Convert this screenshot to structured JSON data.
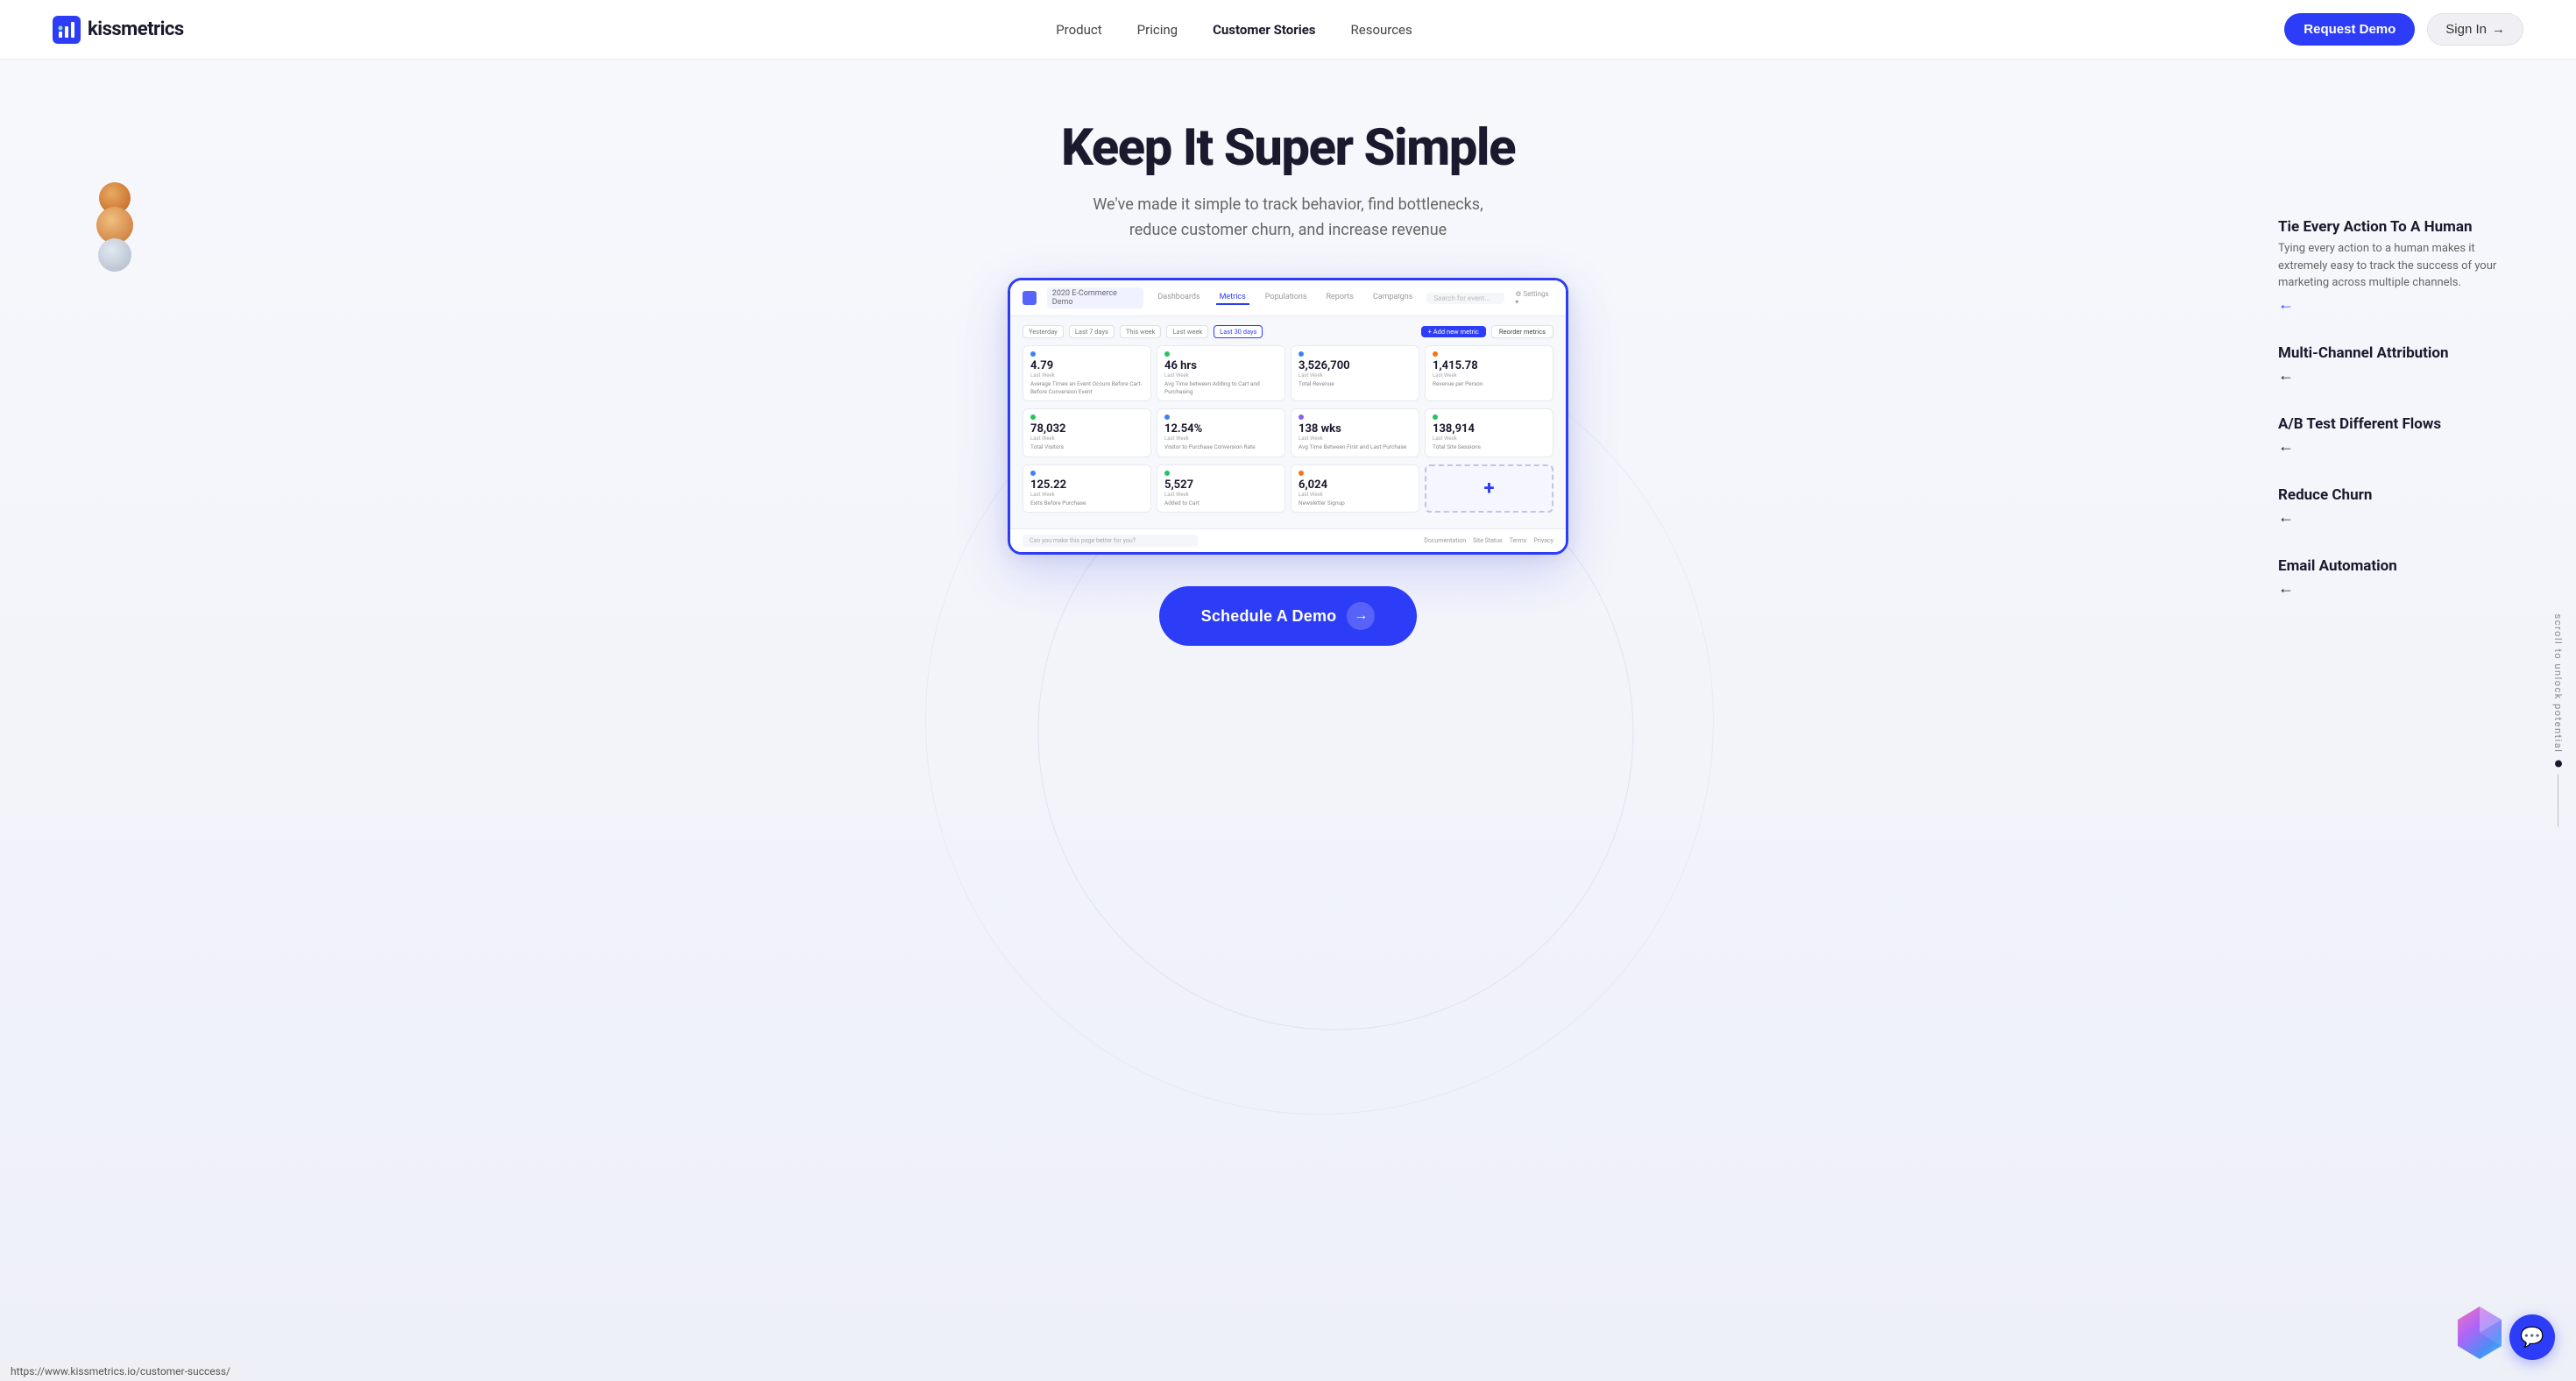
{
  "nav": {
    "logo_text": "kissmetrics",
    "links": [
      {
        "id": "product",
        "label": "Product",
        "active": false
      },
      {
        "id": "pricing",
        "label": "Pricing",
        "active": false
      },
      {
        "id": "customer-stories",
        "label": "Customer Stories",
        "active": true
      },
      {
        "id": "resources",
        "label": "Resources",
        "active": false
      }
    ],
    "request_demo": "Request Demo",
    "sign_in": "Sign In"
  },
  "hero": {
    "title": "Keep It Super Simple",
    "subtitle_line1": "We've made it simple to track behavior, find bottlenecks,",
    "subtitle_line2": "reduce customer churn, and increase revenue"
  },
  "dashboard": {
    "demo_label": "2020 E-Commerce Demo",
    "tabs": [
      "Dashboards",
      "Metrics",
      "Populations",
      "Reports",
      "Campaigns"
    ],
    "active_tab": "Metrics",
    "search_placeholder": "Search for event",
    "settings_label": "Settings",
    "date_filters": [
      "Yesterday",
      "Last 7 days",
      "This week",
      "Last week",
      "Last 30 days"
    ],
    "active_date": "Last 30 days",
    "add_metric_label": "Add new metric",
    "reorder_label": "Reorder metrics",
    "metrics_row1": [
      {
        "value": "4.79",
        "label": "Average Times an Event Occurs Before Cart-Before Conversion Event",
        "last": "Last Week",
        "dot_color": "blue"
      },
      {
        "value": "46 hrs",
        "label": "Avg Time between Adding to Cart and Purchasing",
        "last": "Last Week",
        "dot_color": "green"
      },
      {
        "value": "3,526,700",
        "label": "Total Revenue",
        "last": "Last Week",
        "dot_color": "blue"
      },
      {
        "value": "1,415.78",
        "label": "Revenue per Person",
        "last": "Last Week",
        "dot_color": "orange"
      }
    ],
    "metrics_row2": [
      {
        "value": "78,032",
        "label": "Total Visitors",
        "last": "Last Week",
        "dot_color": "green"
      },
      {
        "value": "12.54%",
        "label": "Visitor to Purchase Conversion Rate",
        "last": "Last Week",
        "dot_color": "blue"
      },
      {
        "value": "138 wks",
        "label": "Avg Time Between First and Last Purchase",
        "last": "Last Week",
        "dot_color": "purple"
      },
      {
        "value": "138,914",
        "label": "Total Site Sessions",
        "last": "Last Week",
        "dot_color": "green"
      }
    ],
    "metrics_row3": [
      {
        "value": "125.22",
        "label": "Exits Before Purchase",
        "last": "Last Week",
        "dot_color": "blue"
      },
      {
        "value": "5,527",
        "label": "Added to Cart",
        "last": "Last Week",
        "dot_color": "green"
      },
      {
        "value": "6,024",
        "label": "Newsletter Signup",
        "last": "Last Week",
        "dot_color": "orange"
      },
      {
        "value": "+",
        "label": "Add new metric",
        "last": "",
        "dot_color": "blue"
      }
    ],
    "footer_input_placeholder": "Can you make this page better for you?",
    "footer_links": [
      "Documentation",
      "Site Status",
      "Terms",
      "Privacy"
    ]
  },
  "features": [
    {
      "id": "tie-action",
      "title": "Tie Every Action To A Human",
      "desc": "Tying every action to a human makes it extremely easy to track the success of your marketing across multiple channels.",
      "has_desc": true,
      "active": true
    },
    {
      "id": "multi-channel",
      "title": "Multi-Channel Attribution",
      "desc": "",
      "has_desc": false,
      "active": false
    },
    {
      "id": "ab-test",
      "title": "A/B Test Different Flows",
      "desc": "",
      "has_desc": false,
      "active": false
    },
    {
      "id": "reduce-churn",
      "title": "Reduce Churn",
      "desc": "",
      "has_desc": false,
      "active": false
    },
    {
      "id": "email-automation",
      "title": "Email Automation",
      "desc": "",
      "has_desc": false,
      "active": false
    }
  ],
  "cta": {
    "label": "Schedule A Demo",
    "arrow": "→"
  },
  "scroll_indicator": {
    "text": "scroll to unlock potential"
  },
  "url_bar": {
    "url": "https://www.kissmetrics.io/customer-success/"
  },
  "icons": {
    "logo": "chart-bar",
    "sign_in_arrow": "→",
    "chat": "💬"
  }
}
